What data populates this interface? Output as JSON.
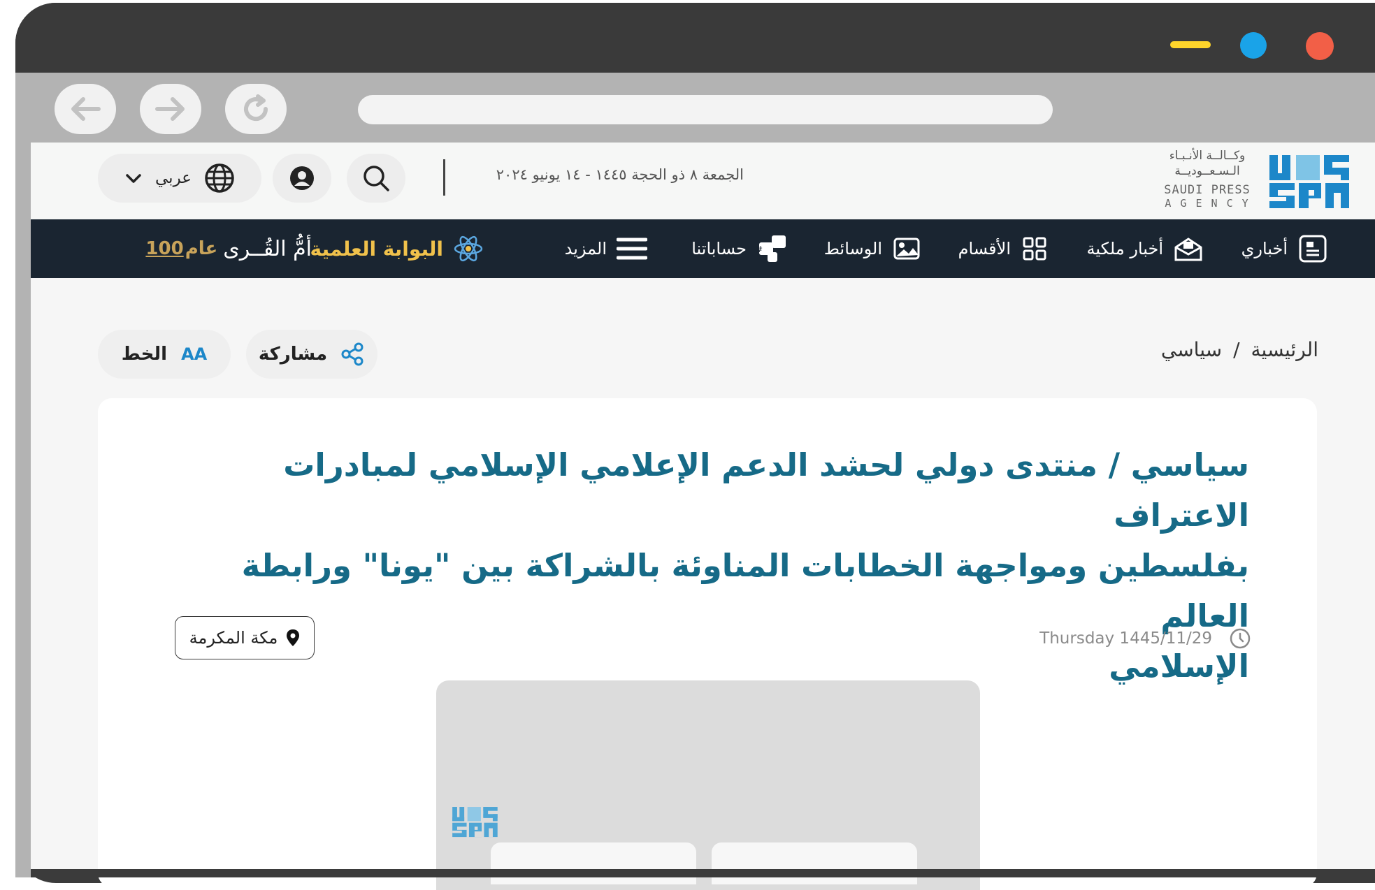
{
  "browser": {
    "window_dots": [
      "#ffd52b",
      "#1aa3e8",
      "#f25f47"
    ],
    "back_icon": "arrow-left-icon",
    "forward_icon": "arrow-right-icon",
    "reload_icon": "reload-icon",
    "address": ""
  },
  "header": {
    "logo_arabic": "وكــالــة الأنـبـاء الـسـعــوديــة",
    "logo_en_line1": "SAUDI PRESS",
    "logo_en_line2": "A G E N C Y",
    "logo_mark": "SPA",
    "date": "الجمعة ٨ ذو الحجة ١٤٤٥ - ١٤ يونيو ٢٠٢٤",
    "language": "عربي"
  },
  "nav": {
    "items": [
      {
        "label": "أخباري",
        "icon": "news-icon"
      },
      {
        "label": "أخبار ملكية",
        "icon": "royal-news-icon"
      },
      {
        "label": "الأقسام",
        "icon": "grid-icon"
      },
      {
        "label": "الوسائط",
        "icon": "media-icon"
      },
      {
        "label": "حساباتنا",
        "icon": "accounts-icon"
      },
      {
        "label": "المزيد",
        "icon": "menu-icon"
      }
    ],
    "science_portal": "البوابة العلمية",
    "umm_alqura": "أمُّ القُــرى",
    "umm_alqura_badge": "100",
    "umm_alqura_badge_suffix": "عام"
  },
  "breadcrumb": {
    "home": "الرئيسية",
    "separator": "/",
    "current": "سياسي"
  },
  "actions": {
    "share": "مشاركة",
    "font": "الخط",
    "font_glyph": "AA"
  },
  "article": {
    "title_lines": [
      "سياسي / منتدى دولي لحشد الدعم الإعلامي الإسلامي لمبادرات الاعتراف",
      "بفلسطين ومواجهة الخطابات المناوئة بالشراكة بين \"يونا\" ورابطة العالم",
      "الإسلامي"
    ],
    "date": "Thursday 1445/11/29",
    "location": "مكة المكرمة"
  },
  "colors": {
    "nav_bg": "#1a2531",
    "title": "#166a87",
    "brand_blue": "#1c87c9",
    "science_gold": "#f0c14b"
  }
}
